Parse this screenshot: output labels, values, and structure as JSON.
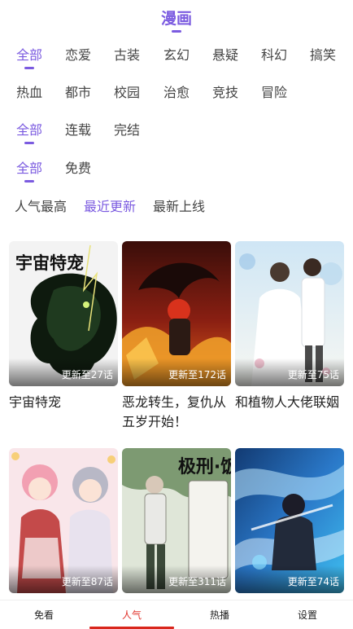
{
  "header": {
    "title": "漫画"
  },
  "filters": {
    "genre_row1": [
      "全部",
      "恋爱",
      "古装",
      "玄幻",
      "悬疑",
      "科幻",
      "搞笑"
    ],
    "genre_row2": [
      "热血",
      "都市",
      "校园",
      "治愈",
      "竞技",
      "冒险"
    ],
    "status": [
      "全部",
      "连载",
      "完结"
    ],
    "price": [
      "全部",
      "免费"
    ]
  },
  "sort": [
    "人气最高",
    "最近更新",
    "最新上线"
  ],
  "comics": [
    {
      "title": "宇宙特宠",
      "update": "更新至27话",
      "cover_text": "宇宙特宠",
      "cover_colors": [
        "#f3f3f3",
        "#0e1a0e"
      ]
    },
    {
      "title": "恶龙转生，复仇从五岁开始！",
      "update": "更新至172话",
      "cover_colors": [
        "#3a0e0a",
        "#e0601a"
      ]
    },
    {
      "title": "和植物人大佬联姻",
      "update": "更新至75话",
      "cover_colors": [
        "#cfe6f5",
        "#f7f7f2"
      ]
    },
    {
      "title": "",
      "update": "更新至87话",
      "cover_colors": [
        "#f9e6ea",
        "#c44a4a"
      ]
    },
    {
      "title": "",
      "update": "更新至311话",
      "cover_text": "极刑·饭",
      "cover_colors": [
        "#dfe6d8",
        "#3c4a3a"
      ]
    },
    {
      "title": "",
      "update": "更新至74话",
      "cover_colors": [
        "#123a72",
        "#3fc0f0"
      ]
    }
  ],
  "tabbar": [
    "免看",
    "人气",
    "热播",
    "设置"
  ]
}
